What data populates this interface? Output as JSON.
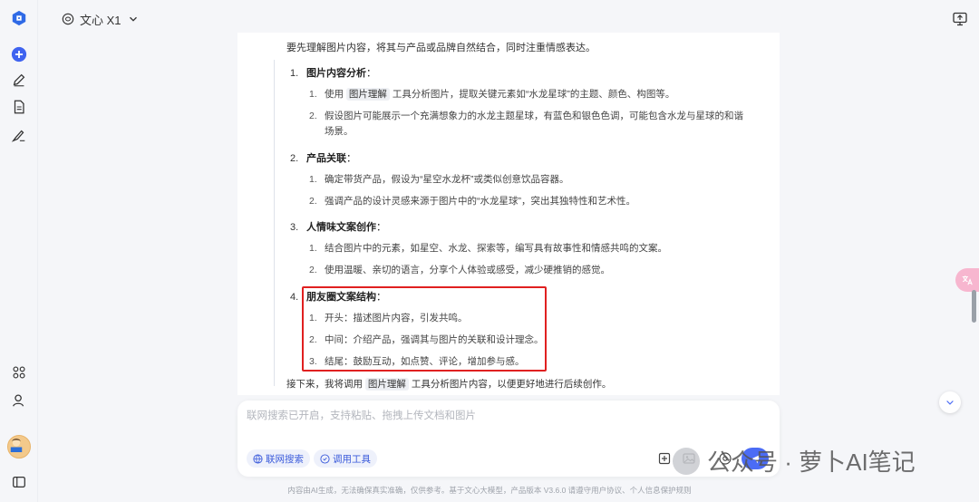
{
  "topbar": {
    "model_name": "文心 X1"
  },
  "content": {
    "intro": "要先理解图片内容，将其与产品或品牌自然结合，同时注重情感表达。",
    "sections": [
      {
        "num": "1.",
        "title": "图片内容分析",
        "colon": "：",
        "items": [
          {
            "num": "1.",
            "pre": "使用",
            "tag": "图片理解",
            "post": "工具分析图片，提取关键元素如“水龙星球”的主题、颜色、构图等。"
          },
          {
            "num": "2.",
            "text": "假设图片可能展示一个充满想象力的水龙主题星球，有蓝色和银色色调，可能包含水龙与星球的和谐",
            "cont": "场景。"
          }
        ]
      },
      {
        "num": "2.",
        "title": "产品关联",
        "colon": "：",
        "items": [
          {
            "num": "1.",
            "text": "确定带货产品，假设为“星空水龙杯”或类似创意饮品容器。"
          },
          {
            "num": "2.",
            "text": "强调产品的设计灵感来源于图片中的“水龙星球”，突出其独特性和艺术性。"
          }
        ]
      },
      {
        "num": "3.",
        "title": "人情味文案创作",
        "colon": "：",
        "items": [
          {
            "num": "1.",
            "text": "结合图片中的元素，如星空、水龙、探索等，编写具有故事性和情感共鸣的文案。"
          },
          {
            "num": "2.",
            "text": "使用温暖、亲切的语言，分享个人体验或感受，减少硬推销的感觉。"
          }
        ]
      },
      {
        "num": "4.",
        "title": "朋友圈文案结构",
        "colon": "：",
        "items": [
          {
            "num": "1.",
            "text": "开头：描述图片内容，引发共鸣。"
          },
          {
            "num": "2.",
            "text": "中间：介绍产品，强调其与图片的关联和设计理念。"
          },
          {
            "num": "3.",
            "text": "结尾：鼓励互动，如点赞、评论，增加参与感。"
          }
        ]
      }
    ],
    "outro_pre": "接下来，我将调用",
    "outro_tag": "图片理解",
    "outro_post": "工具分析图片内容，以便更好地进行后续创作。"
  },
  "input": {
    "placeholder": "联网搜索已开启，支持粘贴、拖拽上传文档和图片",
    "chip_search": "联网搜索",
    "chip_tools": "调用工具"
  },
  "watermark": "公众号 · 萝卜AI笔记",
  "footer": "内容由AI生成，无法确保真实准确，仅供参考。基于文心大模型，产品版本 V3.6.0 请遵守用户协议、个人信息保护规则",
  "colors": {
    "accent": "#4b6cf5",
    "highlight_box": "#e02020",
    "brand": "#2f6ae6"
  }
}
